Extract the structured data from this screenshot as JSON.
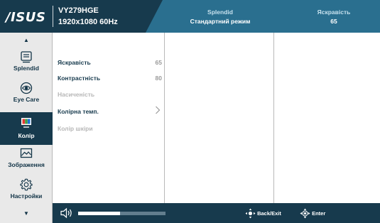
{
  "header": {
    "logo": "/ISUS",
    "model": "VY279HGE",
    "resolution": "1920x1080 60Hz",
    "splendid_label": "Splendid",
    "splendid_value": "Стандартний режим",
    "brightness_label": "Яскравість",
    "brightness_value": "65"
  },
  "sidebar": {
    "items": [
      {
        "label": "Splendid",
        "icon": "splendid-icon"
      },
      {
        "label": "Eye Care",
        "icon": "eye-icon"
      },
      {
        "label": "Колір",
        "icon": "color-icon"
      },
      {
        "label": "Зображення",
        "icon": "image-icon"
      },
      {
        "label": "Настройки",
        "icon": "gear-icon"
      }
    ],
    "selected": "Колір",
    "up_arrow": "▲",
    "down_arrow": "▼"
  },
  "menu": {
    "items": [
      {
        "label": "Яскравість",
        "value": "65"
      },
      {
        "label": "Контрастність",
        "value": "80"
      },
      {
        "label": "Насиченість"
      },
      {
        "label": "Колірна темп."
      },
      {
        "label": "Колір шкіри"
      }
    ]
  },
  "footer": {
    "volume_level": 0.48,
    "back_exit_label": "Back/Exit",
    "enter_label": "Enter"
  },
  "colors": {
    "header_bg": "#173a4d",
    "header_accent": "#2a6f8f",
    "sidebar_bg": "#e9e9e9",
    "selected_bg": "#173a4d",
    "footer_bg": "#173a4d"
  }
}
